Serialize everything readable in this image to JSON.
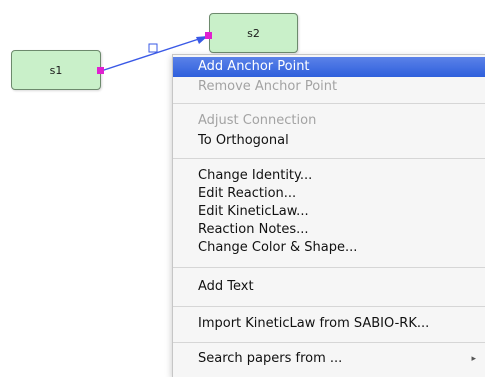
{
  "diagram": {
    "nodes": {
      "s1": {
        "label": "s1"
      },
      "s2": {
        "label": "s2"
      }
    },
    "colors": {
      "node_fill": "#c9f0c9",
      "node_border": "#6d8a6d",
      "edge": "#3a59e6",
      "anchor_handle": "#e020d0",
      "midpoint_handle": "#ffffff"
    }
  },
  "context_menu": {
    "highlight_color": "#2e5fdc",
    "items": [
      {
        "label": "Add Anchor Point",
        "state": "highlighted"
      },
      {
        "label": "Remove Anchor Point",
        "state": "disabled"
      },
      {
        "label": "Adjust Connection",
        "state": "disabled"
      },
      {
        "label": "To Orthogonal",
        "state": "enabled"
      },
      {
        "label": "Change Identity...",
        "state": "enabled"
      },
      {
        "label": "Edit Reaction...",
        "state": "enabled"
      },
      {
        "label": "Edit KineticLaw...",
        "state": "enabled"
      },
      {
        "label": "Reaction Notes...",
        "state": "enabled"
      },
      {
        "label": "Change Color & Shape...",
        "state": "enabled"
      },
      {
        "label": "Add Text",
        "state": "enabled"
      },
      {
        "label": "Import KineticLaw from SABIO-RK...",
        "state": "enabled"
      },
      {
        "label": "Search papers from ...",
        "state": "enabled",
        "submenu": true
      }
    ],
    "submenu_arrow": "▸"
  }
}
